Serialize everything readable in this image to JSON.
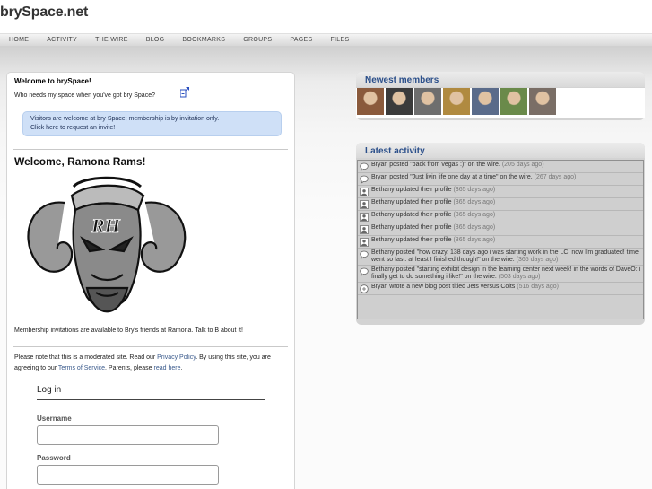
{
  "site": {
    "title": "brySpace.net"
  },
  "nav": {
    "items": [
      "HOME",
      "ACTIVITY",
      "THE WIRE",
      "BLOG",
      "BOOKMARKS",
      "GROUPS",
      "PAGES",
      "FILES"
    ]
  },
  "welcome": {
    "title": "Welcome to brySpace!",
    "subtitle": "Who needs my space when you've got bry Space?",
    "visitor_line1": "Visitors are welcome at bry Space; membership is by invitation only.",
    "visitor_line2": "Click here to request an invite!",
    "greeting": "Welcome, Ramona Rams!",
    "membership_text": "Membership invitations are available to Bry's friends at Ramona.  Talk to B about it!",
    "note_p1": "Please note that this is a moderated site.  Read our ",
    "privacy_link": "Privacy Policy",
    "note_p2": ".  By using this site, you are agreeing to our ",
    "terms_link": "Terms of Service",
    "note_p3": ".  Parents, please ",
    "readhere_link": "read here",
    "note_p4": "."
  },
  "login": {
    "title": "Log in",
    "username_label": "Username",
    "username_value": "",
    "password_label": "Password",
    "password_value": ""
  },
  "newest_members": {
    "title": "Newest members",
    "avatar_colors": [
      "#8a5a3c",
      "#3b3b3b",
      "#6e6e6e",
      "#b08a40",
      "#5a6b8a",
      "#6a8a4a",
      "#7a6e66"
    ]
  },
  "latest_activity": {
    "title": "Latest activity",
    "items": [
      {
        "icon": "speech-bubble-icon",
        "text": "Bryan posted \"back from vegas :)\" on the wire.",
        "time": "(205 days ago)"
      },
      {
        "icon": "speech-bubble-icon",
        "text": "Bryan posted \"Just livin life one day at a time\" on the wire.",
        "time": "(267 days ago)"
      },
      {
        "icon": "profile-icon",
        "text": "Bethany updated their profile",
        "time": "(365 days ago)"
      },
      {
        "icon": "profile-icon",
        "text": "Bethany updated their profile",
        "time": "(365 days ago)"
      },
      {
        "icon": "profile-icon",
        "text": "Bethany updated their profile",
        "time": "(365 days ago)"
      },
      {
        "icon": "profile-icon",
        "text": "Bethany updated their profile",
        "time": "(365 days ago)"
      },
      {
        "icon": "profile-icon",
        "text": "Bethany updated their profile",
        "time": "(365 days ago)"
      },
      {
        "icon": "speech-bubble-icon",
        "text": "Bethany posted \"how crazy. 138 days ago i was starting work in the LC. now I'm graduated! time went so fast. at least I finished though!\" on the wire.",
        "time": "(365 days ago)"
      },
      {
        "icon": "speech-bubble-icon",
        "text": "Bethany posted \"starting exhibit design in the learning center next week! in the words of DaveO: i finally get to do something i like!\" on the wire.",
        "time": "(503 days ago)"
      },
      {
        "icon": "blog-icon",
        "text": "Bryan wrote a new blog post titled Jets versus Colts",
        "time": "(516 days ago)"
      }
    ]
  }
}
